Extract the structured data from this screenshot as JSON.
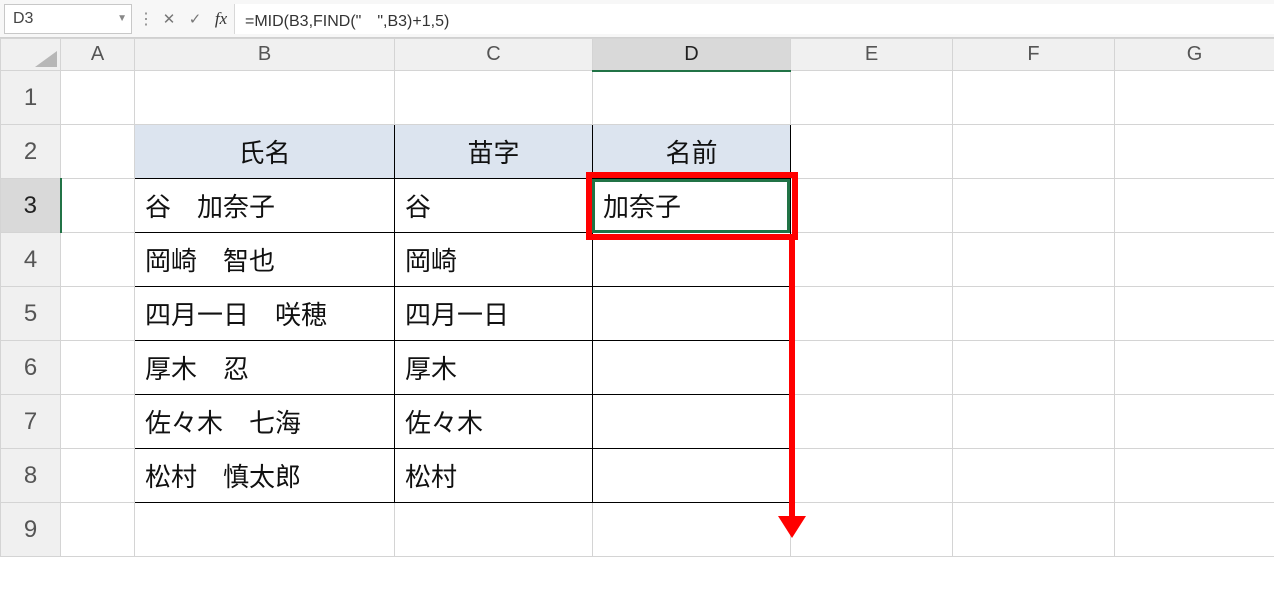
{
  "formula_bar": {
    "cell_ref": "D3",
    "cancel_glyph": "✕",
    "confirm_glyph": "✓",
    "fx_label": "fx",
    "formula": "=MID(B3,FIND(\"　\",B3)+1,5)"
  },
  "columns": [
    "A",
    "B",
    "C",
    "D",
    "E",
    "F",
    "G"
  ],
  "rows": [
    "1",
    "2",
    "3",
    "4",
    "5",
    "6",
    "7",
    "8",
    "9"
  ],
  "selected_cell": {
    "col": "D",
    "row": "3"
  },
  "headers": {
    "B": "氏名",
    "C": "苗字",
    "D": "名前"
  },
  "data_rows": [
    {
      "B": "谷　加奈子",
      "C": "谷",
      "D": "加奈子"
    },
    {
      "B": "岡崎　智也",
      "C": "岡崎",
      "D": ""
    },
    {
      "B": "四月一日　咲穂",
      "C": "四月一日",
      "D": ""
    },
    {
      "B": "厚木　忍",
      "C": "厚木",
      "D": ""
    },
    {
      "B": "佐々木　七海",
      "C": "佐々木",
      "D": ""
    },
    {
      "B": "松村　慎太郎",
      "C": "松村",
      "D": ""
    }
  ],
  "annotations": {
    "red_box_target": "D3",
    "red_arrow_from": "D3",
    "red_arrow_to": "D8"
  }
}
